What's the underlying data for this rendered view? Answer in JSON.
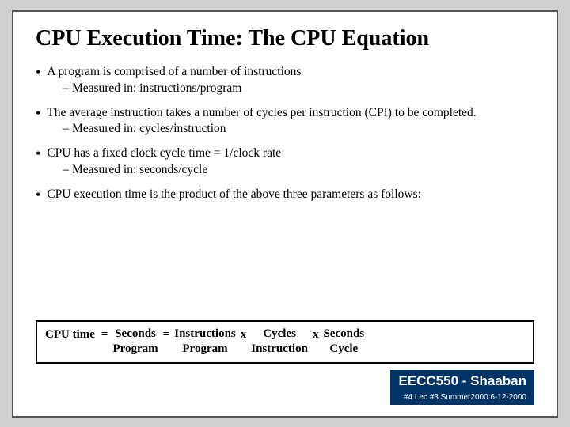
{
  "slide": {
    "title": "CPU Execution Time: The CPU Equation",
    "bullets": [
      {
        "main": "A program is comprised of a number of instructions",
        "sub": "– Measured in:       instructions/program"
      },
      {
        "main": "The average instruction takes a number of cycles per instruction (CPI) to be completed.",
        "sub": "– Measured in:   cycles/instruction"
      },
      {
        "main": "CPU has a fixed clock cycle time = 1/clock rate",
        "sub": "– Measured in:       seconds/cycle"
      },
      {
        "main": "CPU execution time is the product of the above three parameters as follows:",
        "sub": null
      }
    ],
    "equation": {
      "label": "CPU time",
      "equals": "=",
      "terms": [
        {
          "top": "Seconds",
          "bottom": "Program"
        },
        {
          "separator": "="
        },
        {
          "top": "Instructions",
          "bottom": "Program"
        },
        {
          "separator": "x"
        },
        {
          "top": "Cycles",
          "bottom": "Instruction"
        },
        {
          "separator": "x"
        },
        {
          "top": "Seconds",
          "bottom": "Cycle"
        }
      ]
    },
    "footer": {
      "badge": "EECC550 - Shaaban",
      "subtext": "#4  Lec #3   Summer2000  6-12-2000"
    }
  }
}
